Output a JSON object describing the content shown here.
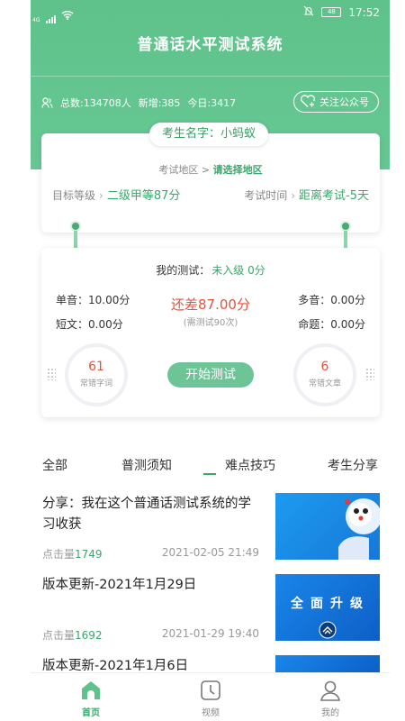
{
  "status_bar": {
    "network": "4G",
    "time": "17:52",
    "battery": "48"
  },
  "header": {
    "title": "普通话水平测试系统",
    "stats": {
      "total": "总数:134708人",
      "new": "新增:385",
      "today": "今日:3417"
    },
    "follow_label": "关注公众号"
  },
  "profile": {
    "name_label": "考生名字：小蚂蚁",
    "region_prefix": "考试地区 > ",
    "region_value": "请选择地区",
    "level_label": "目标等级",
    "level_value": "二级甲等87分",
    "time_label": "考试时间",
    "time_value": "距离考试-5天"
  },
  "test": {
    "label": "我的测试：",
    "level": "未入级 0分",
    "single": "单音：10.00分",
    "short": "短文：0.00分",
    "multi": "多音：0.00分",
    "topic": "命题：0.00分",
    "gap": "还差87.00分",
    "need": "(需测试90次)",
    "wrong_words": {
      "count": "61",
      "label": "常错字词"
    },
    "wrong_articles": {
      "count": "6",
      "label": "常错文章"
    },
    "start_label": "开始测试"
  },
  "tabs": [
    "全部",
    "普测须知",
    "难点技巧",
    "考生分享"
  ],
  "articles": [
    {
      "title": "分享：我在这个普通话测试系统的学习收获",
      "clicks_label": "点击量",
      "clicks": "1749",
      "date": "2021-02-05 21:49"
    },
    {
      "title": "版本更新-2021年1月29日",
      "clicks_label": "点击量",
      "clicks": "1692",
      "date": "2021-01-29 19:40",
      "thumb_text": "全面升级"
    },
    {
      "title": "版本更新-2021年1月6日"
    }
  ],
  "nav": {
    "home": "首页",
    "video": "视频",
    "mine": "我的"
  },
  "colors": {
    "brand": "#5ec28a",
    "accent": "#3aa76c",
    "alert": "#e0533e"
  }
}
